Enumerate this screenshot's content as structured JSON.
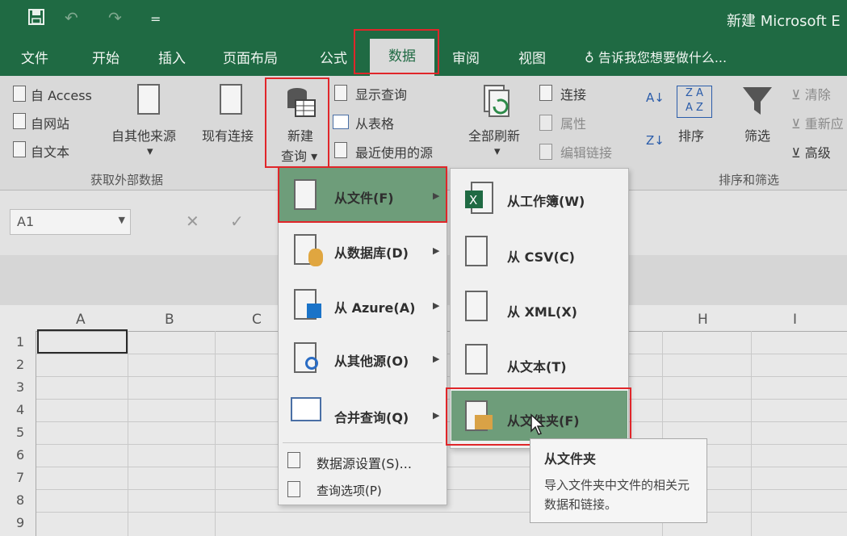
{
  "window": {
    "title": "新建 Microsoft E"
  },
  "quick_access": {
    "save_icon": "save-icon",
    "undo_icon": "undo-icon",
    "redo_icon": "redo-icon",
    "customize": "="
  },
  "tabs": [
    "文件",
    "开始",
    "插入",
    "页面布局",
    "公式",
    "数据",
    "审阅",
    "视图"
  ],
  "active_tab": "数据",
  "tell_me": "告诉我您想要做什么...",
  "ribbon": {
    "get_external": {
      "from_access": "自 Access",
      "from_web": "自网站",
      "from_text": "自文本",
      "from_other": "自其他来源",
      "existing": "现有连接",
      "label": "获取外部数据"
    },
    "new_query": {
      "line1": "新建",
      "line2": "查询"
    },
    "show_queries": "显示查询",
    "from_table": "从表格",
    "recent_sources": "最近使用的源",
    "refresh_all": "全部刷新",
    "connections": "连接",
    "properties": "属性",
    "edit_links": "编辑链接",
    "sort": "排序",
    "filter": "筛选",
    "clear": "清除",
    "reapply": "重新应",
    "advanced": "高级",
    "sort_filter_label": "排序和筛选"
  },
  "formula_bar": {
    "name_box": "A1",
    "cancel": "✕",
    "enter": "✓"
  },
  "grid": {
    "columns": [
      "A",
      "B",
      "C",
      "H",
      "I"
    ],
    "rows": [
      "1",
      "2",
      "3",
      "4",
      "5",
      "6",
      "7",
      "8",
      "9"
    ]
  },
  "menu_new_query": [
    {
      "label": "从文件(F)",
      "submenu": true,
      "highlighted": true
    },
    {
      "label": "从数据库(D)",
      "submenu": true
    },
    {
      "label": "从 Azure(A)",
      "submenu": true
    },
    {
      "label": "从其他源(O)",
      "submenu": true
    },
    {
      "label": "合并查询(Q)",
      "submenu": true
    },
    {
      "label": "数据源设置(S)..."
    },
    {
      "label": "查询选项(P)"
    }
  ],
  "menu_from_file": [
    {
      "label": "从工作簿(W)"
    },
    {
      "label": "从 CSV(C)"
    },
    {
      "label": "从 XML(X)"
    },
    {
      "label": "从文本(T)"
    },
    {
      "label": "从文件夹(F)",
      "highlighted": true
    }
  ],
  "tooltip": {
    "title": "从文件夹",
    "body": "导入文件夹中文件的相关元数据和链接。"
  },
  "colors": {
    "excel_green": "#1f6a43",
    "highlight": "#6e9d7a",
    "callout_red": "#e0262a"
  }
}
